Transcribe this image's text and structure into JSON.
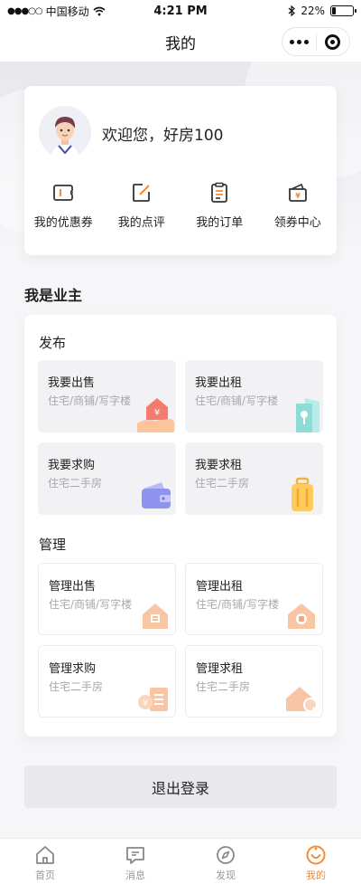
{
  "status": {
    "carrier": "中国移动",
    "time": "4:21 PM",
    "battery": "22%",
    "battery_level": 0.22
  },
  "nav": {
    "title": "我的"
  },
  "profile": {
    "welcome": "欢迎您，好房100",
    "quick_links": [
      {
        "label": "我的优惠券",
        "icon": "coupon-icon"
      },
      {
        "label": "我的点评",
        "icon": "edit-review-icon"
      },
      {
        "label": "我的订单",
        "icon": "order-list-icon"
      },
      {
        "label": "领券中心",
        "icon": "wallet-yen-icon"
      }
    ]
  },
  "owner": {
    "title": "我是业主",
    "publish": {
      "label": "发布",
      "tiles": [
        {
          "title": "我要出售",
          "sub": "住宅/商铺/写字楼",
          "icon": "house-hand-icon"
        },
        {
          "title": "我要出租",
          "sub": "住宅/商铺/写字楼",
          "icon": "key-door-icon"
        },
        {
          "title": "我要求购",
          "sub": "住宅二手房",
          "icon": "wallet-icon"
        },
        {
          "title": "我要求租",
          "sub": "住宅二手房",
          "icon": "luggage-icon"
        }
      ]
    },
    "manage": {
      "label": "管理",
      "tiles": [
        {
          "title": "管理出售",
          "sub": "住宅/商铺/写字楼",
          "icon": "house-icon"
        },
        {
          "title": "管理出租",
          "sub": "住宅/商铺/写字楼",
          "icon": "house-doc-icon"
        },
        {
          "title": "管理求购",
          "sub": "住宅二手房",
          "icon": "yen-list-icon"
        },
        {
          "title": "管理求租",
          "sub": "住宅二手房",
          "icon": "house-search-icon"
        }
      ]
    }
  },
  "logout_label": "退出登录",
  "tabbar": [
    {
      "label": "首页",
      "icon": "home-icon"
    },
    {
      "label": "消息",
      "icon": "message-icon"
    },
    {
      "label": "发现",
      "icon": "compass-icon"
    },
    {
      "label": "我的",
      "icon": "profile-smile-icon",
      "active": true
    }
  ],
  "colors": {
    "accent": "#f28c38",
    "background": "#f6f6f8"
  }
}
